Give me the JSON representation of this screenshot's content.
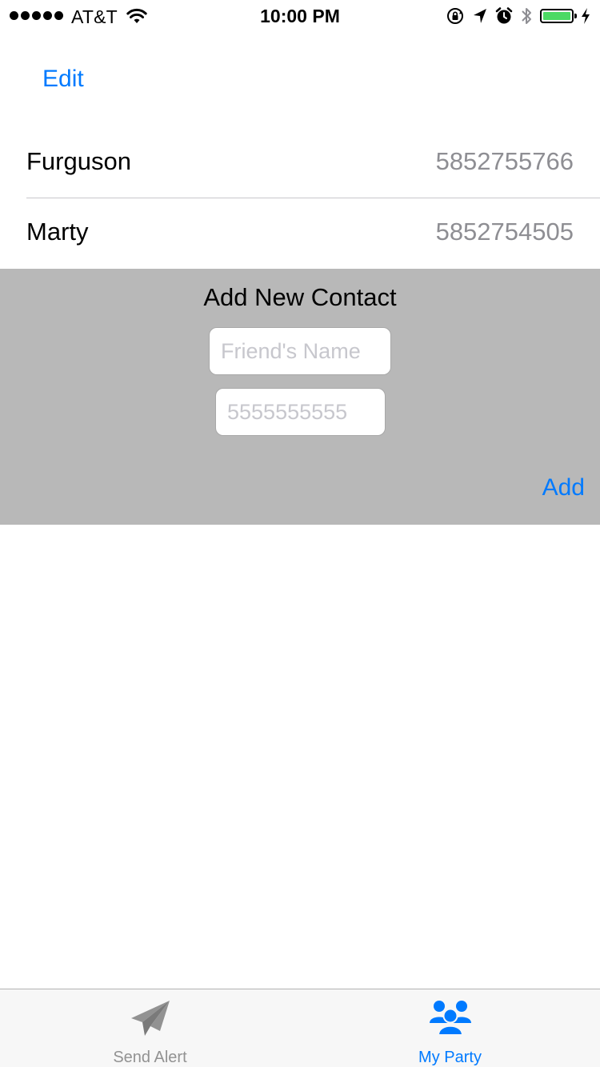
{
  "status_bar": {
    "carrier": "AT&T",
    "time": "10:00 PM",
    "signal_bars": 5,
    "battery_level": 1.0,
    "battery_color": "#4cd964"
  },
  "nav": {
    "edit_label": "Edit"
  },
  "contacts": [
    {
      "name": "Furguson",
      "phone": "5852755766"
    },
    {
      "name": "Marty",
      "phone": "5852754505"
    }
  ],
  "add_contact": {
    "title": "Add New Contact",
    "name_placeholder": "Friend's Name",
    "phone_placeholder": "5555555555",
    "add_label": "Add",
    "background": "#b8b8b8"
  },
  "tabs": [
    {
      "label": "Send Alert",
      "icon": "paper-plane-icon",
      "selected": false
    },
    {
      "label": "My Party",
      "icon": "group-icon",
      "selected": true
    }
  ],
  "colors": {
    "accent": "#007aff",
    "inactive_tab": "#929292",
    "secondary_text": "#8e8e93"
  }
}
